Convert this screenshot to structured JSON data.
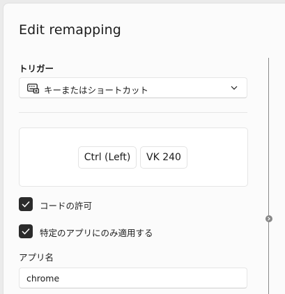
{
  "dialog": {
    "title": "Edit remapping"
  },
  "trigger": {
    "label": "トリガー",
    "combo_value": "キーまたはショートカット",
    "combo_icon": "keyboard-icon"
  },
  "keys": [
    {
      "label": "Ctrl (Left)"
    },
    {
      "label": "VK 240"
    }
  ],
  "options": {
    "allow_chord": {
      "label": "コードの許可",
      "checked": true
    },
    "app_specific": {
      "label": "特定のアプリにのみ適用する",
      "checked": true
    }
  },
  "app_name": {
    "label": "アプリ名",
    "value": "chrome"
  },
  "colors": {
    "accent_checkbox": "#2b2b2b",
    "surface": "#fbfbfb",
    "border": "#e5e5e5"
  }
}
